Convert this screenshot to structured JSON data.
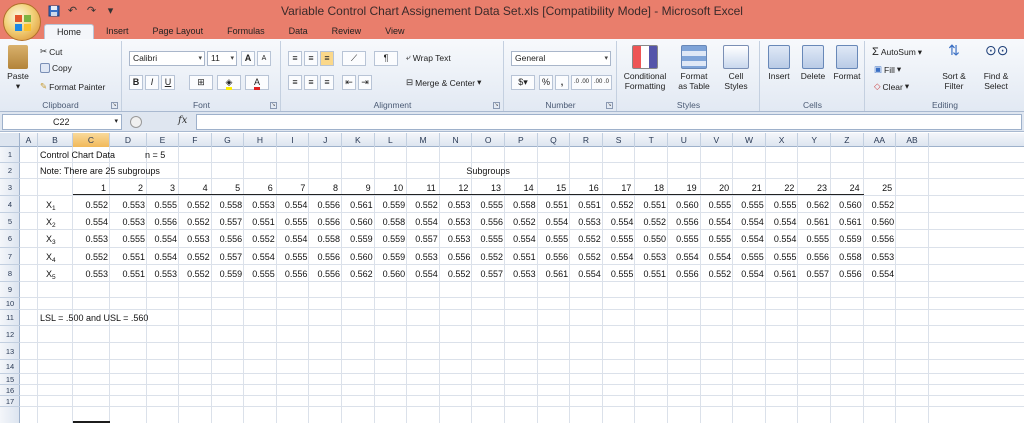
{
  "window": {
    "title": "Variable Control Chart Assignement Data Set.xls  [Compatibility Mode]  -  Microsoft Excel"
  },
  "tabs": [
    "Home",
    "Insert",
    "Page Layout",
    "Formulas",
    "Data",
    "Review",
    "View"
  ],
  "active_tab": "Home",
  "ribbon": {
    "clipboard": {
      "label": "Clipboard",
      "paste": "Paste",
      "cut": "Cut",
      "copy": "Copy",
      "format_painter": "Format Painter"
    },
    "font": {
      "label": "Font",
      "font_name": "Calibri",
      "font_size": "11",
      "bold": "B",
      "italic": "I",
      "underline": "U",
      "grow": "A",
      "shrink": "A"
    },
    "alignment": {
      "label": "Alignment",
      "wrap_text": "Wrap Text",
      "merge_center": "Merge & Center"
    },
    "number": {
      "label": "Number",
      "format": "General",
      "percent": "%",
      "comma": ",",
      "inc_decimal": ".0 .00",
      "dec_decimal": ".00 .0"
    },
    "styles": {
      "label": "Styles",
      "conditional_formatting": [
        "Conditional",
        "Formatting"
      ],
      "format_as_table": [
        "Format",
        "as Table"
      ],
      "cell_styles": [
        "Cell",
        "Styles"
      ]
    },
    "cells": {
      "label": "Cells",
      "insert": "Insert",
      "delete": "Delete",
      "format": "Format"
    },
    "editing": {
      "label": "Editing",
      "autosum": "AutoSum",
      "fill": "Fill",
      "clear": "Clear",
      "sort_filter": [
        "Sort &",
        "Filter"
      ],
      "find_select": [
        "Find &",
        "Select"
      ]
    }
  },
  "formula_bar": {
    "name_box": "C22",
    "fx": "fx",
    "content": ""
  },
  "columns": [
    "A",
    "B",
    "C",
    "D",
    "E",
    "F",
    "G",
    "H",
    "I",
    "J",
    "K",
    "L",
    "M",
    "N",
    "O",
    "P",
    "Q",
    "R",
    "S",
    "T",
    "U",
    "V",
    "W",
    "X",
    "Y",
    "Z",
    "AA",
    "AB"
  ],
  "selected_column": "C",
  "rows": [
    "1",
    "2",
    "3",
    "4",
    "5",
    "6",
    "7",
    "8",
    "9",
    "10",
    "11",
    "12",
    "13",
    "14",
    "15",
    "16",
    "17"
  ],
  "sheet": {
    "title": "Control Chart Data",
    "n_label": "n = 5",
    "note": "Note: There are 25 subgroups",
    "subgroups_label": "Subgroups",
    "subgroup_numbers": [
      "1",
      "2",
      "3",
      "4",
      "5",
      "6",
      "7",
      "8",
      "9",
      "10",
      "11",
      "12",
      "13",
      "14",
      "15",
      "16",
      "17",
      "18",
      "19",
      "20",
      "21",
      "22",
      "23",
      "24",
      "25"
    ],
    "series": [
      {
        "label": "X",
        "sub": "1",
        "values": [
          "0.552",
          "0.553",
          "0.555",
          "0.552",
          "0.558",
          "0.553",
          "0.554",
          "0.556",
          "0.561",
          "0.559",
          "0.552",
          "0.553",
          "0.555",
          "0.558",
          "0.551",
          "0.551",
          "0.552",
          "0.551",
          "0.560",
          "0.555",
          "0.555",
          "0.555",
          "0.562",
          "0.560",
          "0.552"
        ]
      },
      {
        "label": "X",
        "sub": "2",
        "values": [
          "0.554",
          "0.553",
          "0.556",
          "0.552",
          "0.557",
          "0.551",
          "0.555",
          "0.556",
          "0.560",
          "0.558",
          "0.554",
          "0.553",
          "0.556",
          "0.552",
          "0.554",
          "0.553",
          "0.554",
          "0.552",
          "0.556",
          "0.554",
          "0.554",
          "0.554",
          "0.561",
          "0.561",
          "0.560"
        ]
      },
      {
        "label": "X",
        "sub": "3",
        "values": [
          "0.553",
          "0.555",
          "0.554",
          "0.553",
          "0.556",
          "0.552",
          "0.554",
          "0.558",
          "0.559",
          "0.559",
          "0.557",
          "0.553",
          "0.555",
          "0.554",
          "0.555",
          "0.552",
          "0.555",
          "0.550",
          "0.555",
          "0.555",
          "0.554",
          "0.554",
          "0.555",
          "0.559",
          "0.556"
        ]
      },
      {
        "label": "X",
        "sub": "4",
        "values": [
          "0.552",
          "0.551",
          "0.554",
          "0.552",
          "0.557",
          "0.554",
          "0.555",
          "0.556",
          "0.560",
          "0.559",
          "0.553",
          "0.556",
          "0.552",
          "0.551",
          "0.556",
          "0.552",
          "0.554",
          "0.553",
          "0.554",
          "0.554",
          "0.555",
          "0.555",
          "0.556",
          "0.558",
          "0.553"
        ]
      },
      {
        "label": "X",
        "sub": "5",
        "values": [
          "0.553",
          "0.551",
          "0.553",
          "0.552",
          "0.559",
          "0.555",
          "0.556",
          "0.556",
          "0.562",
          "0.560",
          "0.554",
          "0.552",
          "0.557",
          "0.553",
          "0.561",
          "0.554",
          "0.555",
          "0.551",
          "0.556",
          "0.552",
          "0.554",
          "0.561",
          "0.557",
          "0.556",
          "0.554"
        ]
      }
    ],
    "limits_note": "LSL = .500 and USL = .560"
  }
}
